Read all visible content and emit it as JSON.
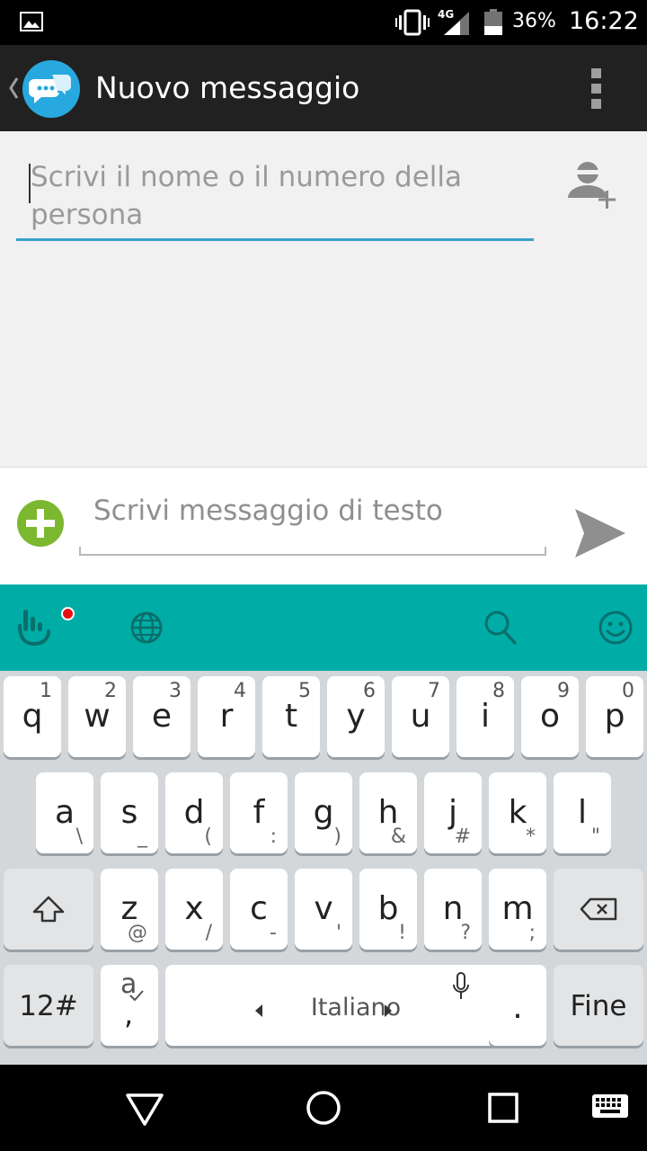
{
  "status_bar": {
    "network": "4G",
    "battery": "36%",
    "time": "16:22"
  },
  "action_bar": {
    "title": "Nuovo messaggio"
  },
  "recipient": {
    "placeholder": "Scrivi il nome o il numero della persona"
  },
  "compose": {
    "placeholder": "Scrivi messaggio di testo"
  },
  "keyboard": {
    "row1": [
      {
        "key": "q",
        "num": "1"
      },
      {
        "key": "w",
        "num": "2"
      },
      {
        "key": "e",
        "num": "3"
      },
      {
        "key": "r",
        "num": "4"
      },
      {
        "key": "t",
        "num": "5"
      },
      {
        "key": "y",
        "num": "6"
      },
      {
        "key": "u",
        "num": "7"
      },
      {
        "key": "i",
        "num": "8"
      },
      {
        "key": "o",
        "num": "9"
      },
      {
        "key": "p",
        "num": "0"
      }
    ],
    "row2": [
      {
        "key": "a",
        "sub": "\\"
      },
      {
        "key": "s",
        "sub": "_"
      },
      {
        "key": "d",
        "sub": "("
      },
      {
        "key": "f",
        "sub": ":"
      },
      {
        "key": "g",
        "sub": ")"
      },
      {
        "key": "h",
        "sub": "&"
      },
      {
        "key": "j",
        "sub": "#"
      },
      {
        "key": "k",
        "sub": "*"
      },
      {
        "key": "l",
        "sub": "\""
      }
    ],
    "row3": [
      {
        "key": "z",
        "sub": "@"
      },
      {
        "key": "x",
        "sub": "/"
      },
      {
        "key": "c",
        "sub": "-"
      },
      {
        "key": "v",
        "sub": "'"
      },
      {
        "key": "b",
        "sub": "!"
      },
      {
        "key": "n",
        "sub": "?"
      },
      {
        "key": "m",
        "sub": ";"
      }
    ],
    "symbols_label": "12#",
    "suggest_key_top": "a",
    "suggest_key_bottom": ",",
    "space_label": "Italiano",
    "period_label": ".",
    "done_label": "Fine"
  },
  "colors": {
    "accent": "#00aca6",
    "input_underline": "#3aa0c8",
    "attach_green": "#7cb82f",
    "notif_red": "#e81010"
  }
}
